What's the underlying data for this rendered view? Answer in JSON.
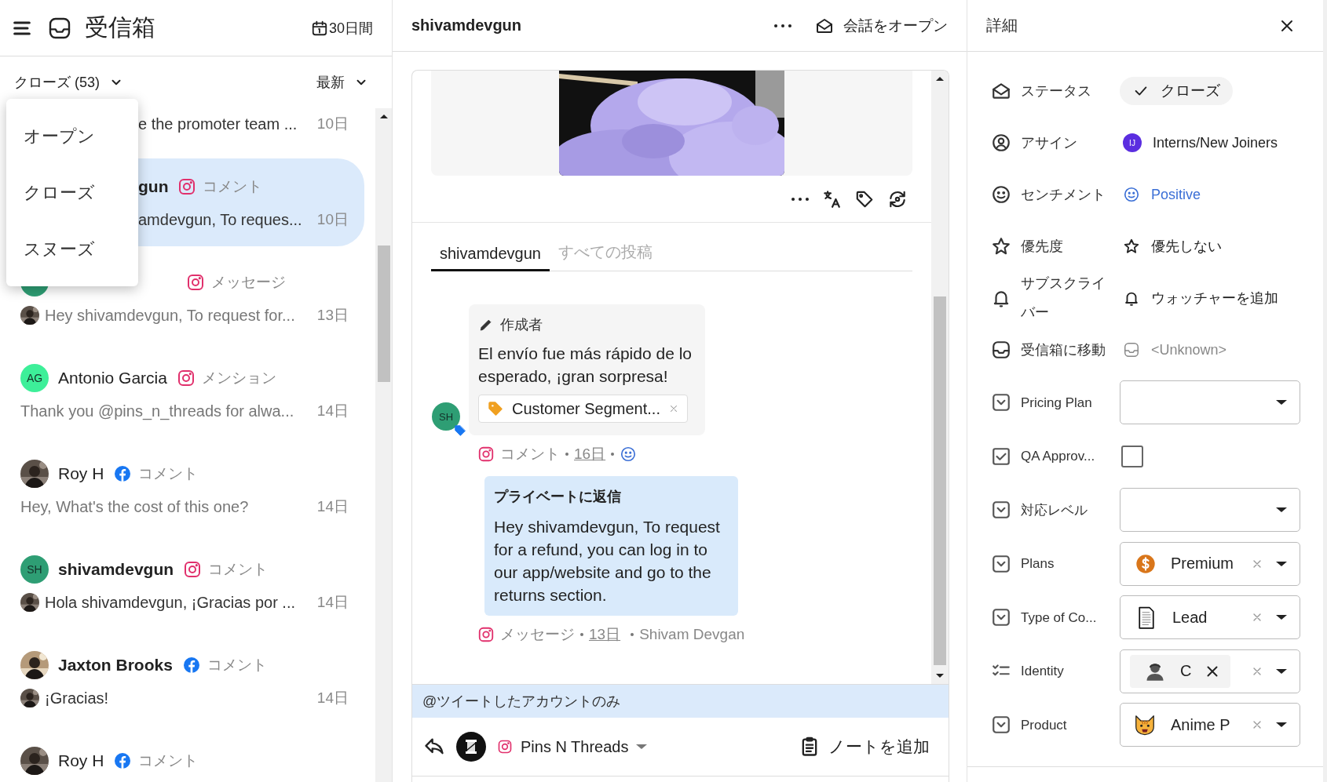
{
  "inbox": {
    "title": "受信箱",
    "period": "30日間",
    "filter": "クローズ (53)",
    "sort": "最新",
    "filter_menu": [
      {
        "label": "オープン"
      },
      {
        "label": "クローズ"
      },
      {
        "label": "スヌーズ"
      }
    ],
    "conversations": [
      {
        "selected": false,
        "unread": true,
        "reply_avatar": false,
        "preview": "e the promoter team ...",
        "date": "10日"
      },
      {
        "selected": true,
        "unread": true,
        "name": "gun",
        "channel": {
          "kind": "instagram"
        },
        "type": "コメント",
        "reply_avatar": false,
        "preview": "amdevgun, To reques...",
        "date": "10日"
      },
      {
        "selected": false,
        "unread": false,
        "avatar": {
          "kind": "initials",
          "color": "#2e9e74"
        },
        "channel": {
          "kind": "instagram"
        },
        "type": "メッセージ",
        "reply_avatar": true,
        "preview": "Hey shivamdevgun, To request for...",
        "date": "13日"
      },
      {
        "selected": false,
        "unread": false,
        "avatar": {
          "kind": "initials",
          "text": "AG",
          "color": "#3def99"
        },
        "name": "Antonio Garcia",
        "channel": {
          "kind": "instagram"
        },
        "type": "メンション",
        "reply_avatar": false,
        "preview": "Thank you @pins_n_threads for alwa...",
        "date": "14日"
      },
      {
        "selected": false,
        "unread": false,
        "name": "Roy H",
        "channel": {
          "kind": "facebook"
        },
        "type": "コメント",
        "reply_avatar": false,
        "preview": "Hey, What's the cost of this one?",
        "date": "14日"
      },
      {
        "selected": false,
        "unread": true,
        "avatar": {
          "kind": "initials",
          "text": "SH",
          "color": "#2e9e74"
        },
        "name": "shivamdevgun",
        "channel": {
          "kind": "instagram"
        },
        "type": "コメント",
        "reply_avatar": true,
        "preview": "Hola shivamdevgun, ¡Gracias por ...",
        "date": "14日"
      },
      {
        "selected": false,
        "unread": true,
        "name": "Jaxton Brooks",
        "channel": {
          "kind": "facebook"
        },
        "type": "コメント",
        "reply_avatar": true,
        "preview": "¡Gracias!",
        "date": "14日"
      },
      {
        "selected": false,
        "unread": false,
        "name": "Roy H",
        "channel": {
          "kind": "facebook"
        },
        "type": "コメント"
      }
    ]
  },
  "conversation": {
    "title": "shivamdevgun",
    "open_button": "会話をオープン",
    "tabs": [
      {
        "label": "shivamdevgun",
        "selected": true
      },
      {
        "label": "すべての投稿",
        "selected": false
      }
    ],
    "post": {
      "author_label": "作成者",
      "text": "El envío fue más rápido de lo esperado, ¡gran sorpresa!",
      "tag": "Customer Segment...",
      "avatar": "SH",
      "meta": {
        "channel": {
          "kind": "instagram"
        },
        "type": "コメント",
        "date": "16日"
      }
    },
    "reply": {
      "title": "プライベートに返信",
      "text": "Hey shivamdevgun, To request for a refund, you can log in to our app/website and go to the returns section.",
      "meta": {
        "channel": {
          "kind": "instagram"
        },
        "type": "メッセージ",
        "date": "13日",
        "author": "Shivam Devgan"
      }
    },
    "composer": {
      "banner": "@ツイートしたアカウントのみ",
      "account": "Pins N Threads",
      "note_button": "ノートを追加"
    }
  },
  "details": {
    "title": "詳細",
    "rows": [
      {
        "kind": "status",
        "label": "ステータス",
        "value": "クローズ"
      },
      {
        "kind": "assignee",
        "label": "アサイン",
        "initials": "IJ",
        "value": "Interns/New Joiners"
      },
      {
        "kind": "sentiment",
        "label": "センチメント",
        "value": "Positive"
      },
      {
        "kind": "priority",
        "label": "優先度",
        "value": "優先しない"
      },
      {
        "kind": "watchers",
        "label": "サブスクライバー",
        "value": "ウォッチャーを追加"
      },
      {
        "kind": "inbox",
        "label": "受信箱に移動",
        "value": "<Unknown>"
      },
      {
        "kind": "select",
        "label": "Pricing Plan"
      },
      {
        "kind": "checkbox",
        "label": "QA Approv...",
        "checked": false
      },
      {
        "kind": "select",
        "label": "対応レベル"
      },
      {
        "kind": "plan",
        "label": "Plans",
        "value": "Premium"
      },
      {
        "kind": "contact_type",
        "label": "Type of Co...",
        "value": "Lead"
      },
      {
        "kind": "identity",
        "label": "Identity",
        "value": "C"
      },
      {
        "kind": "product",
        "label": "Product",
        "value": "Anime P"
      }
    ]
  }
}
